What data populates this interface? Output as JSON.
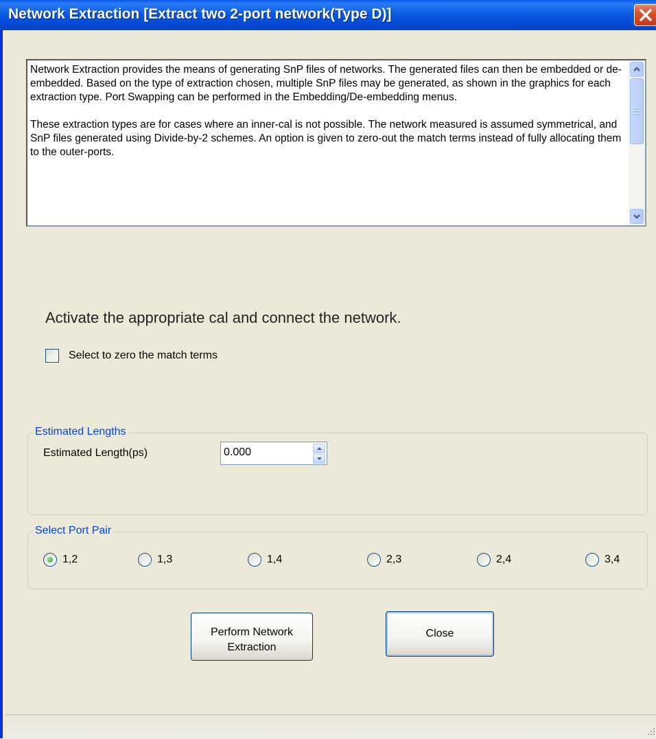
{
  "window": {
    "title": "Network Extraction [Extract two 2-port network(Type D)]"
  },
  "description": {
    "paragraphs": [
      "Network Extraction provides the means of generating SnP files of networks.  The generated files can then be embedded or de-embedded.  Based on the type of extraction chosen, multiple SnP files may be generated, as shown in the graphics for each extraction type.  Port Swapping can be performed in the Embedding/De-embedding menus.",
      "These extraction types are for cases where an inner-cal is not possible.  The network measured is assumed symmetrical, and  SnP files generated using Divide-by-2 schemes.  An option is given to zero-out the match terms instead of fully allocating them to the outer-ports."
    ]
  },
  "instruction": "Activate the appropriate cal and connect the network.",
  "zero_match": {
    "label": "Select to zero the match terms",
    "checked": false
  },
  "estimated_lengths": {
    "group_title": "Estimated Lengths",
    "label": "Estimated Length(ps)",
    "value": "0.000"
  },
  "port_pair": {
    "group_title": "Select Port Pair",
    "options": [
      {
        "label": "1,2",
        "selected": true
      },
      {
        "label": "1,3",
        "selected": false
      },
      {
        "label": "1,4",
        "selected": false
      },
      {
        "label": "2,3",
        "selected": false
      },
      {
        "label": "2,4",
        "selected": false
      },
      {
        "label": "3,4",
        "selected": false
      }
    ]
  },
  "buttons": {
    "perform_line1": "Perform Network",
    "perform_line2": "Extraction",
    "close": "Close"
  },
  "colors": {
    "titlebar": "#0548d6",
    "group_title": "#0046d5",
    "dialog_bg": "#ece9d8",
    "close_button": "#d9512c"
  },
  "icons": {
    "close": "close-x-icon",
    "scroll_up": "chevron-up-icon",
    "scroll_down": "chevron-down-icon",
    "resize": "resize-grip-icon"
  }
}
